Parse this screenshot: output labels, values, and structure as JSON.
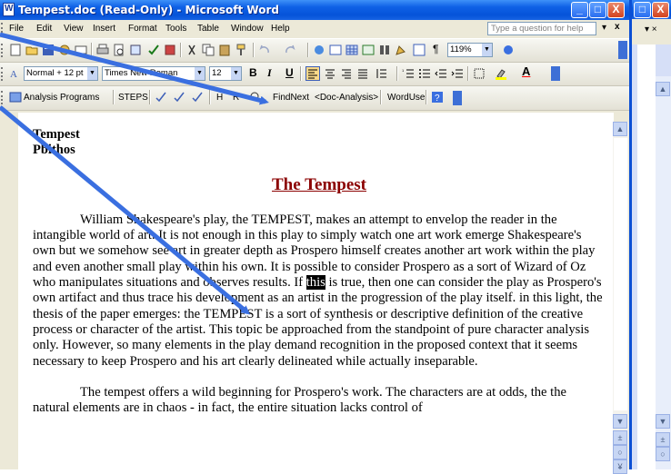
{
  "window": {
    "title": "Tempest.doc (Read-Only) - Microsoft Word",
    "minimize": "_",
    "restore": "□",
    "close": "X"
  },
  "menu": {
    "items": [
      "File",
      "Edit",
      "View",
      "Insert",
      "Format",
      "Tools",
      "Table",
      "Window",
      "Help"
    ],
    "ask_placeholder": "Type a question for help",
    "close_doc": "x"
  },
  "formatting": {
    "style": "Normal + 12 pt",
    "font": "Times New Roman",
    "size": "12",
    "bold": "B",
    "italic": "I",
    "underline": "U",
    "font_color_letter": "A"
  },
  "standard": {
    "zoom": "119%",
    "pilcrow": "¶"
  },
  "custom_toolbar": {
    "items": [
      "Analysis Programs",
      "STEPS",
      "H",
      "R",
      "FindNext",
      "<Doc-Analysis>",
      "WordUse"
    ]
  },
  "document": {
    "header_line1": "Tempest",
    "header_line2": "Pbithos",
    "title": "The Tempest",
    "p1_before": "William Shakespeare's play, the TEMPEST, makes an attempt to envelop the reader in the intangible world of art.  It is not enough in this play to simply watch one art work emerge Shakespeare's own but we somehow see art in greater depth as Prospero himself creates another art work within the play and even another small play within his own.  It is possible to consider Prospero as a sort of Wizard of Oz who manipulates situations and observes results.  If ",
    "p1_selected": "this",
    "p1_after": " is true, then one can consider the play as Prospero's own artifact and thus trace his development as an artist in the progression of the play itself.  in this light, the thesis of the paper emerges: the TEMPEST is a sort of synthesis or descriptive definition of the creative process or character of the artist.  This topic be approached from the standpoint of pure character analysis only.  However, so many elements in the play demand recognition in the proposed context that it seems necessary to keep Prospero and his art clearly delineated while actually inseparable.",
    "p2": "The tempest offers a wild beginning for Prospero's work.  The characters are at odds, the the natural elements are in chaos  - in fact, the entire situation lacks control of"
  },
  "colors": {
    "title_red": "#8b0000",
    "titlebar_blue": "#0553d9",
    "arrow_blue": "#3a6fe0"
  }
}
